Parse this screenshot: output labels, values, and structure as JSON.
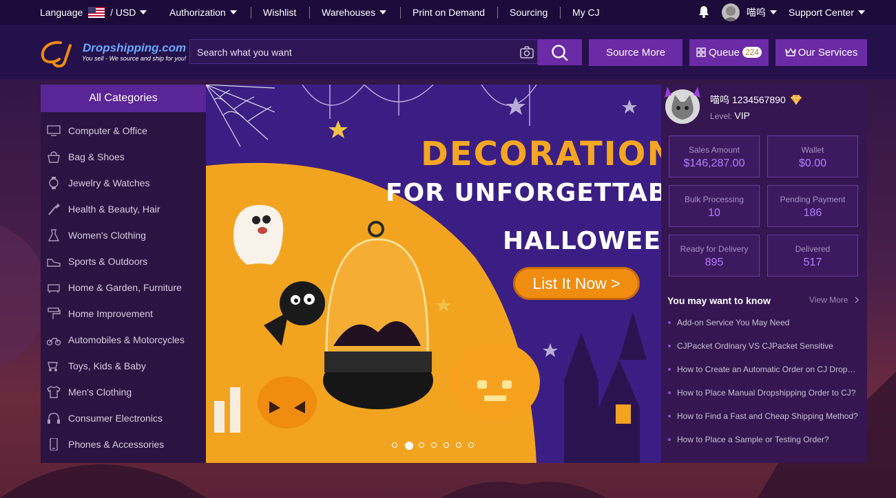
{
  "topbar": {
    "language_label": "Language",
    "currency": "/ USD",
    "authorization": "Authorization",
    "wishlist": "Wishlist",
    "warehouses": "Warehouses",
    "print_on_demand": "Print on Demand",
    "sourcing": "Sourcing",
    "my_cj": "My CJ",
    "username": "喵呜",
    "support": "Support Center"
  },
  "header": {
    "logo_name": "Dropshipping.com",
    "logo_tagline": "You sell - We source and ship for you!",
    "search_placeholder": "Search what you want",
    "source_more": "Source More",
    "queue_label": "Queue",
    "queue_count": "224",
    "our_services": "Our Services"
  },
  "sidebar": {
    "title": "All Categories",
    "items": [
      {
        "label": "Computer & Office",
        "icon": "monitor-icon"
      },
      {
        "label": "Bag & Shoes",
        "icon": "bag-icon"
      },
      {
        "label": "Jewelry & Watches",
        "icon": "watch-icon"
      },
      {
        "label": "Health & Beauty, Hair",
        "icon": "brush-icon"
      },
      {
        "label": "Women's Clothing",
        "icon": "dress-icon"
      },
      {
        "label": "Sports & Outdoors",
        "icon": "shoe-icon"
      },
      {
        "label": "Home & Garden, Furniture",
        "icon": "sofa-icon"
      },
      {
        "label": "Home Improvement",
        "icon": "paint-roller-icon"
      },
      {
        "label": "Automobiles & Motorcycles",
        "icon": "motorcycle-icon"
      },
      {
        "label": "Toys, Kids & Baby",
        "icon": "stroller-icon"
      },
      {
        "label": "Men's Clothing",
        "icon": "shirt-icon"
      },
      {
        "label": "Consumer Electronics",
        "icon": "headphones-icon"
      },
      {
        "label": "Phones & Accessories",
        "icon": "phone-icon"
      }
    ]
  },
  "banner": {
    "line1": "DECORATIONS",
    "line2": "FOR UNFORGETTABLE",
    "line3": "HALLOWEEN",
    "cta": "List It Now >",
    "slide_count": 7,
    "active_slide": 2
  },
  "profile": {
    "name": "喵呜 1234567890",
    "level_label": "Level:",
    "level_value": "VIP",
    "stats": [
      {
        "label": "Sales Amount",
        "value": "$146,287.00"
      },
      {
        "label": "Wallet",
        "value": "$0.00"
      },
      {
        "label": "Bulk Processing",
        "value": "10"
      },
      {
        "label": "Pending Payment",
        "value": "186"
      },
      {
        "label": "Ready for Delivery",
        "value": "895"
      },
      {
        "label": "Delivered",
        "value": "517"
      }
    ]
  },
  "know": {
    "title": "You may want to know",
    "view_more": "View More",
    "items": [
      "Add-on Service You May Need",
      "CJPacket Ordinary VS CJPacket Sensitive",
      "How to Create an Automatic Order on CJ Dropshipping?",
      "How to Place Manual Dropshipping Order to CJ?",
      "How to Find a Fast and Cheap Shipping Method?",
      "How to Place a Sample or Testing Order?"
    ]
  },
  "colors": {
    "topbar_bg": "#1c0a3a",
    "header_bg": "#24104a",
    "accent_purple": "#6b2aa6",
    "banner_orange": "#f5a623",
    "stat_value": "#b57cff"
  }
}
